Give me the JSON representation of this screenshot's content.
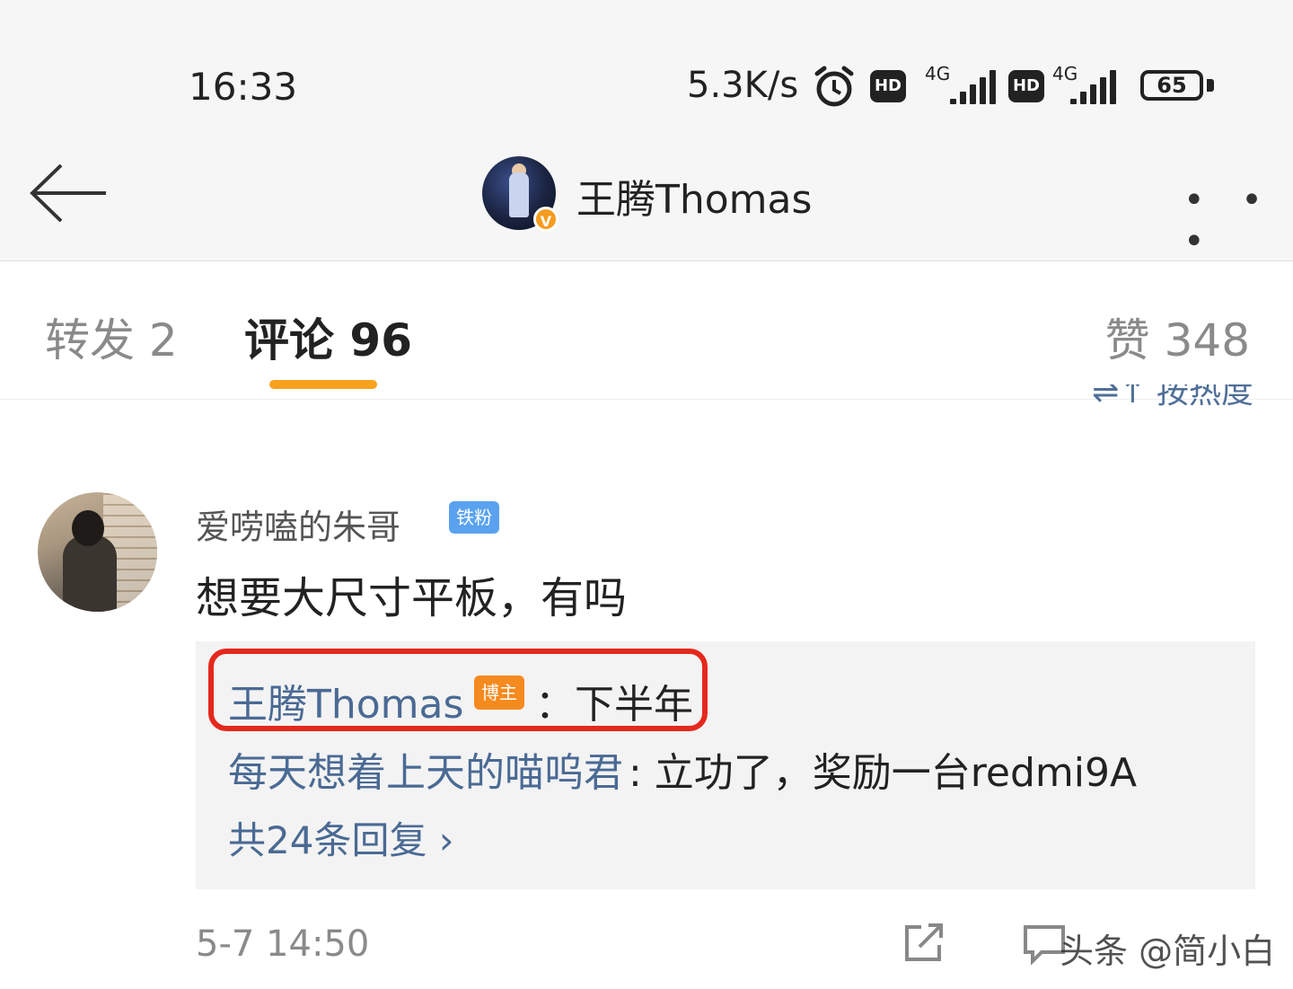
{
  "status_bar": {
    "time": "16:33",
    "speed": "5.3K/s",
    "sim1_network": "4G",
    "sim2_network": "4G",
    "hd_label": "HD",
    "battery": "65"
  },
  "header": {
    "title": "王腾Thomas",
    "verified_badge": "V",
    "more": "• • •"
  },
  "tabs": {
    "forward": "转发 2",
    "comment": "评论 96",
    "like": "赞 348",
    "active_color": "#f7a21e"
  },
  "sort": {
    "label": "⇌↑ 按热度"
  },
  "comment": {
    "user": "爱唠嗑的朱哥",
    "fan_badge": "铁粉",
    "text": "想要大尺寸平板，有吗",
    "replies": [
      {
        "user": "王腾Thomas",
        "badge": "博主",
        "text": "：下半年"
      },
      {
        "user": "每天想着上天的喵呜君",
        "text": ": 立功了，奖励一台redmi9A"
      }
    ],
    "more_replies": "共24条回复 ›",
    "timestamp": "5-7 14:50"
  },
  "watermark": "头条 @简小白",
  "colors": {
    "link": "#4a6a94",
    "highlight_border": "#e5281c",
    "blogger_badge": "#f58a1f",
    "fan_badge": "#5aa2ef"
  }
}
